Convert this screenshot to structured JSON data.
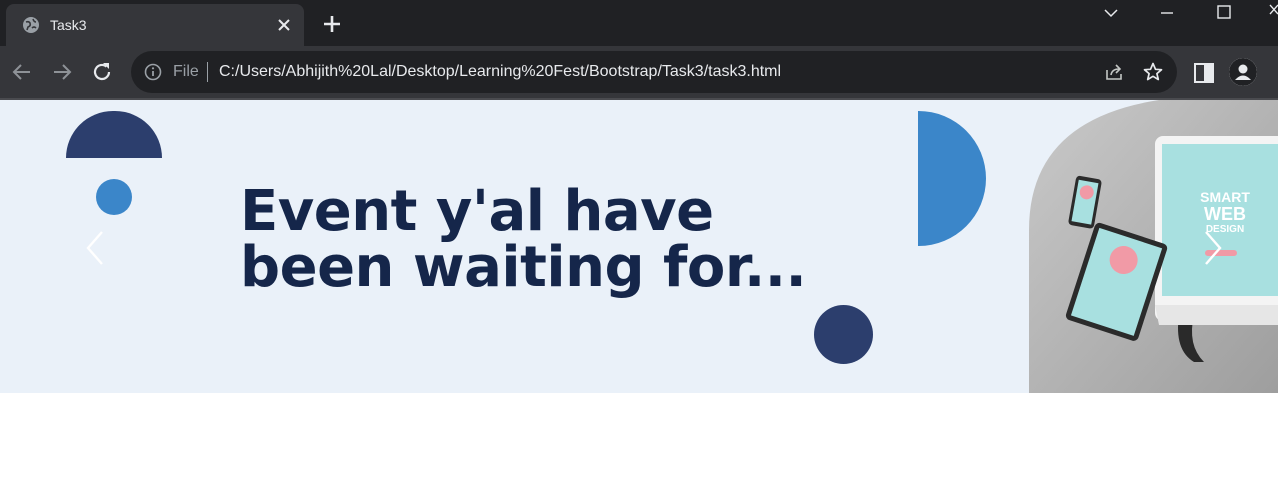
{
  "browser": {
    "tab_title": "Task3",
    "omnibox": {
      "scheme_label": "File",
      "url": "C:/Users/Abhijith%20Lal/Desktop/Learning%20Fest/Bootstrap/Task3/task3.html"
    }
  },
  "hero": {
    "heading_line1": "Event y'al have",
    "heading_line2": "been waiting for...",
    "image_text": {
      "line1": "SMART",
      "line2": "WEB",
      "line3": "DESIGN"
    }
  },
  "colors": {
    "hero_background": "#eaf1f9",
    "navy": "#2c3e6d",
    "blue": "#3b86c9",
    "heading": "#15264a"
  }
}
